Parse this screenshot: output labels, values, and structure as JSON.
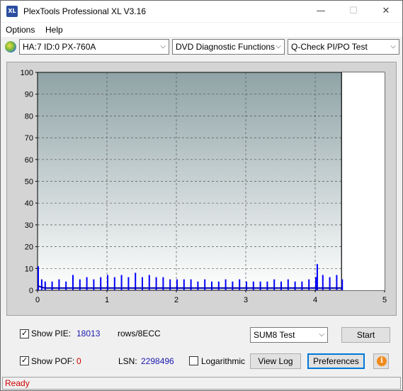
{
  "window": {
    "title": "PlexTools Professional XL V3.16",
    "icon_text": "XL",
    "minimize_glyph": "—",
    "maximize_glyph": "☐",
    "close_glyph": "✕"
  },
  "menu": {
    "items": [
      "Options",
      "Help"
    ]
  },
  "toolbar": {
    "drive": "HA:7 ID:0  PX-760A",
    "function": "DVD Diagnostic Functions",
    "test": "Q-Check PI/PO Test",
    "arrow": "⌵"
  },
  "chart_data": {
    "type": "bar",
    "title": "",
    "xlabel": "",
    "ylabel": "",
    "xlim": [
      0,
      5
    ],
    "ylim": [
      0,
      100
    ],
    "x_ticks": [
      "0",
      "1",
      "2",
      "3",
      "4",
      "5"
    ],
    "y_ticks": [
      "0",
      "10",
      "20",
      "30",
      "40",
      "50",
      "60",
      "70",
      "80",
      "90",
      "100"
    ],
    "grid": true,
    "end_marker_x": 4.38,
    "series": [
      {
        "color": "#0000ff",
        "style": "bars",
        "x": [
          0.0,
          0.05,
          0.1,
          0.2,
          0.3,
          0.4,
          0.5,
          0.6,
          0.7,
          0.8,
          0.9,
          1.0,
          1.1,
          1.2,
          1.3,
          1.4,
          1.5,
          1.6,
          1.7,
          1.8,
          1.9,
          2.0,
          2.1,
          2.2,
          2.3,
          2.4,
          2.5,
          2.6,
          2.7,
          2.8,
          2.9,
          3.0,
          3.1,
          3.2,
          3.3,
          3.4,
          3.5,
          3.6,
          3.7,
          3.8,
          3.9,
          4.0,
          4.02,
          4.1,
          4.2,
          4.3,
          4.38
        ],
        "y": [
          11,
          5,
          4,
          4,
          5,
          4,
          7,
          5,
          6,
          5,
          6,
          7,
          6,
          7,
          6,
          8,
          6,
          7,
          6,
          6,
          5,
          5,
          5,
          5,
          4,
          5,
          4,
          4,
          5,
          4,
          5,
          4,
          4,
          4,
          4,
          5,
          4,
          5,
          4,
          4,
          5,
          6,
          12,
          7,
          6,
          7,
          5
        ]
      },
      {
        "color": "#0000aa",
        "style": "line",
        "x": [
          0.0,
          0.1,
          0.5,
          1.0,
          1.5,
          2.0,
          2.5,
          3.0,
          3.5,
          4.0,
          4.38
        ],
        "y": [
          2,
          1,
          1,
          1,
          1,
          1,
          1,
          1,
          1,
          1,
          1
        ]
      }
    ]
  },
  "bottom": {
    "show_pie_label": "Show PIE:",
    "pie_value": "18013",
    "pie_unit": "rows/8ECC",
    "show_pof_label": "Show POF:",
    "pof_value": "0",
    "lsn_label": "LSN:",
    "lsn_value": "2298496",
    "logarithmic_label": "Logarithmic",
    "test_mode": "SUM8 Test",
    "start_label": "Start",
    "viewlog_label": "View Log",
    "preferences_label": "Preferences",
    "info_glyph": "i",
    "check_glyph": "✓"
  },
  "status": {
    "text": "Ready"
  }
}
